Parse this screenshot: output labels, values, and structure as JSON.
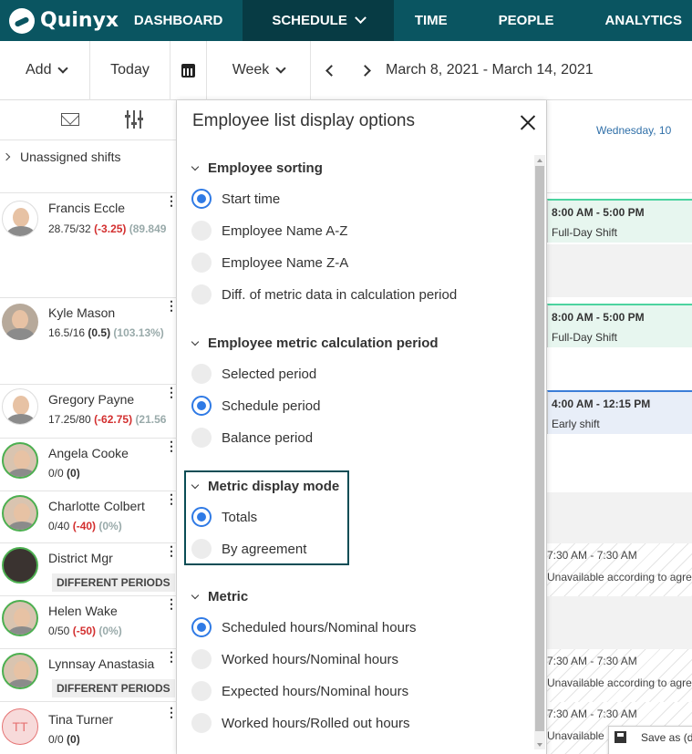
{
  "app": {
    "logo_text": "Quinyx"
  },
  "nav": {
    "items": [
      {
        "label": "DASHBOARD",
        "active": false
      },
      {
        "label": "SCHEDULE",
        "active": true
      },
      {
        "label": "TIME",
        "active": false
      },
      {
        "label": "PEOPLE",
        "active": false
      },
      {
        "label": "ANALYTICS",
        "active": false
      }
    ]
  },
  "toolbar": {
    "add_label": "Add",
    "today_label": "Today",
    "view_label": "Week",
    "date_range": "March 8, 2021 - March 14, 2021"
  },
  "left": {
    "unassigned_label": "Unassigned shifts",
    "employees": [
      {
        "name": "Francis Eccle",
        "base": "28.75/32",
        "delta": "(-3.25)",
        "pct": "(89.849"
      },
      {
        "name": "Kyle Mason",
        "base": "16.5/16",
        "delta": "(0.5)",
        "pct": "(103.13%)"
      },
      {
        "name": "Gregory Payne",
        "base": "17.25/80",
        "delta": "(-62.75)",
        "pct": "(21.56"
      },
      {
        "name": "Angela Cooke",
        "base": "0/0",
        "delta": "(0)",
        "pct": ""
      },
      {
        "name": "Charlotte Colbert",
        "base": "0/40",
        "delta": "(-40)",
        "pct": "(0%)"
      },
      {
        "name": "District Mgr",
        "badge": "DIFFERENT PERIODS"
      },
      {
        "name": "Helen Wake",
        "base": "0/50",
        "delta": "(-50)",
        "pct": "(0%)"
      },
      {
        "name": "Lynnsay Anastasia",
        "badge": "DIFFERENT PERIODS"
      },
      {
        "name": "Tina Turner",
        "initials": "TT",
        "base": "0/0",
        "delta": "(0)",
        "pct": ""
      }
    ]
  },
  "schedule": {
    "day_header": "Wednesday, 10",
    "shifts": [
      {
        "time": "8:00 AM - 5:00 PM",
        "name": "Full-Day Shift"
      },
      {
        "time": "8:00 AM - 5:00 PM",
        "name": "Full-Day Shift"
      },
      {
        "time": "4:00 AM - 12:15 PM",
        "name": "Early shift"
      }
    ],
    "unavailable": [
      {
        "time": "7:30 AM - 7:30 AM",
        "text": "Unavailable according to agre"
      },
      {
        "time": "7:30 AM - 7:30 AM",
        "text": "Unavailable according to agre"
      },
      {
        "time": "7:30 AM - 7:30 AM",
        "text": "Unavailable"
      }
    ],
    "context_menu_label": "Save as (di"
  },
  "dialog": {
    "title": "Employee list display options",
    "sections": [
      {
        "title": "Employee sorting",
        "options": [
          {
            "label": "Start time",
            "selected": true
          },
          {
            "label": "Employee Name A-Z",
            "selected": false
          },
          {
            "label": "Employee Name Z-A",
            "selected": false
          },
          {
            "label": "Diff. of metric data in calculation period",
            "selected": false
          }
        ]
      },
      {
        "title": "Employee metric calculation period",
        "options": [
          {
            "label": "Selected period",
            "selected": false
          },
          {
            "label": "Schedule period",
            "selected": true
          },
          {
            "label": "Balance period",
            "selected": false
          }
        ]
      },
      {
        "title": "Metric display mode",
        "options": [
          {
            "label": "Totals",
            "selected": true
          },
          {
            "label": "By agreement",
            "selected": false
          }
        ]
      },
      {
        "title": "Metric",
        "options": [
          {
            "label": "Scheduled hours/Nominal hours",
            "selected": true
          },
          {
            "label": "Worked hours/Nominal hours",
            "selected": false
          },
          {
            "label": "Expected hours/Nominal hours",
            "selected": false
          },
          {
            "label": "Worked hours/Rolled out hours",
            "selected": false
          }
        ]
      }
    ]
  },
  "colors": {
    "nav_bg": "#0a5561",
    "nav_active": "#073b44",
    "accent": "#2f7ae5",
    "negative": "#d32f2f",
    "shift_green": "#4cd3a0",
    "shift_blue": "#3b7dd8"
  }
}
